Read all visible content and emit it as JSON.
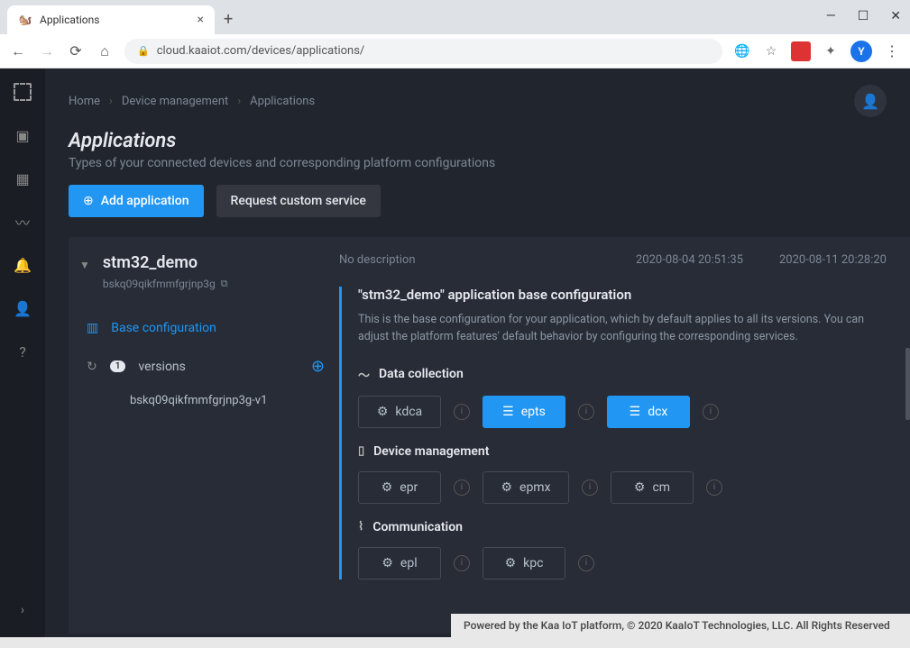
{
  "window": {
    "tab_title": "Applications",
    "tab_letter": "Y"
  },
  "browser": {
    "url": "cloud.kaaiot.com/devices/applications/"
  },
  "breadcrumbs": {
    "home": "Home",
    "dm": "Device management",
    "apps": "Applications"
  },
  "header": {
    "title": "Applications",
    "subtitle": "Types of your connected devices and corresponding platform configurations",
    "add_btn": "Add application",
    "req_btn": "Request custom service"
  },
  "app": {
    "name": "stm32_demo",
    "id": "bskq09qikfmmfgrjnp3g",
    "no_desc": "No description",
    "ts1": "2020-08-04 20:51:35",
    "ts2": "2020-08-11 20:28:20"
  },
  "tree": {
    "base": "Base configuration",
    "versions": "versions",
    "badge": "1",
    "v1": "bskq09qikfmmfgrjnp3g-v1"
  },
  "config": {
    "title": "\"stm32_demo\" application base configuration",
    "desc": "This is the base configuration for your application, which by default applies to all its versions. You can adjust the platform features' default behavior by configuring the corresponding services."
  },
  "sections": {
    "data": {
      "title": "Data collection",
      "items": [
        "kdca",
        "epts",
        "dcx"
      ]
    },
    "device": {
      "title": "Device management",
      "items": [
        "epr",
        "epmx",
        "cm"
      ]
    },
    "comm": {
      "title": "Communication",
      "items": [
        "epl",
        "kpc"
      ]
    }
  },
  "footer": "Powered by the Kaa IoT platform, © 2020 KaaIoT Technologies, LLC. All Rights Reserved"
}
